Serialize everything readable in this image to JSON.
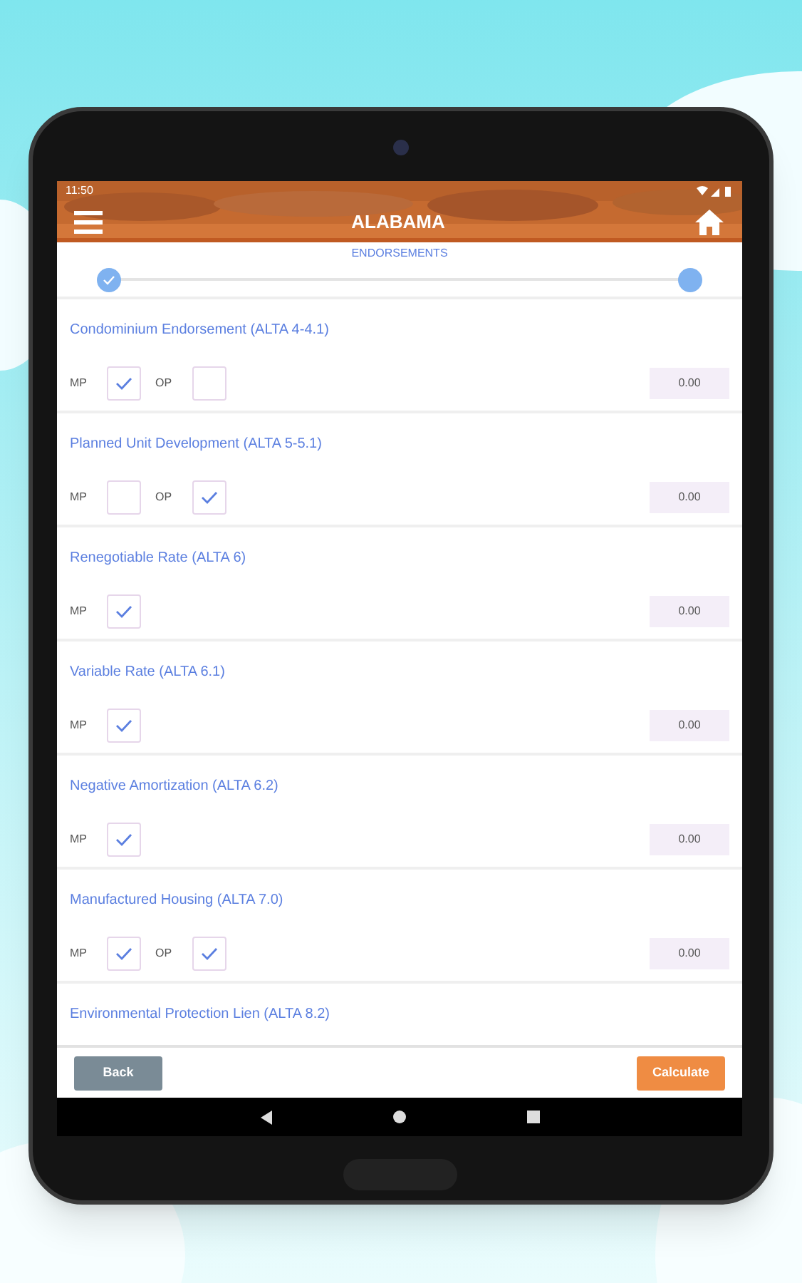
{
  "status_bar": {
    "time": "11:50"
  },
  "header": {
    "title": "ALABAMA"
  },
  "stepper": {
    "title": "ENDORSEMENTS",
    "steps": [
      {
        "completed": true
      },
      {
        "completed": false
      }
    ]
  },
  "endorsements": [
    {
      "name": "Condominium Endorsement (ALTA 4-4.1)",
      "options": [
        {
          "label": "MP",
          "checked": true
        },
        {
          "label": "OP",
          "checked": false
        }
      ],
      "amount": "0.00"
    },
    {
      "name": "Planned Unit Development (ALTA 5-5.1)",
      "options": [
        {
          "label": "MP",
          "checked": false
        },
        {
          "label": "OP",
          "checked": true
        }
      ],
      "amount": "0.00"
    },
    {
      "name": "Renegotiable Rate (ALTA 6)",
      "options": [
        {
          "label": "MP",
          "checked": true
        }
      ],
      "amount": "0.00"
    },
    {
      "name": "Variable Rate (ALTA 6.1)",
      "options": [
        {
          "label": "MP",
          "checked": true
        }
      ],
      "amount": "0.00"
    },
    {
      "name": "Negative Amortization (ALTA 6.2)",
      "options": [
        {
          "label": "MP",
          "checked": true
        }
      ],
      "amount": "0.00"
    },
    {
      "name": "Manufactured Housing (ALTA 7.0)",
      "options": [
        {
          "label": "MP",
          "checked": true
        },
        {
          "label": "OP",
          "checked": true
        }
      ],
      "amount": "0.00"
    },
    {
      "name": "Environmental Protection Lien (ALTA 8.2)"
    }
  ],
  "footer": {
    "back": "Back",
    "calculate": "Calculate"
  }
}
